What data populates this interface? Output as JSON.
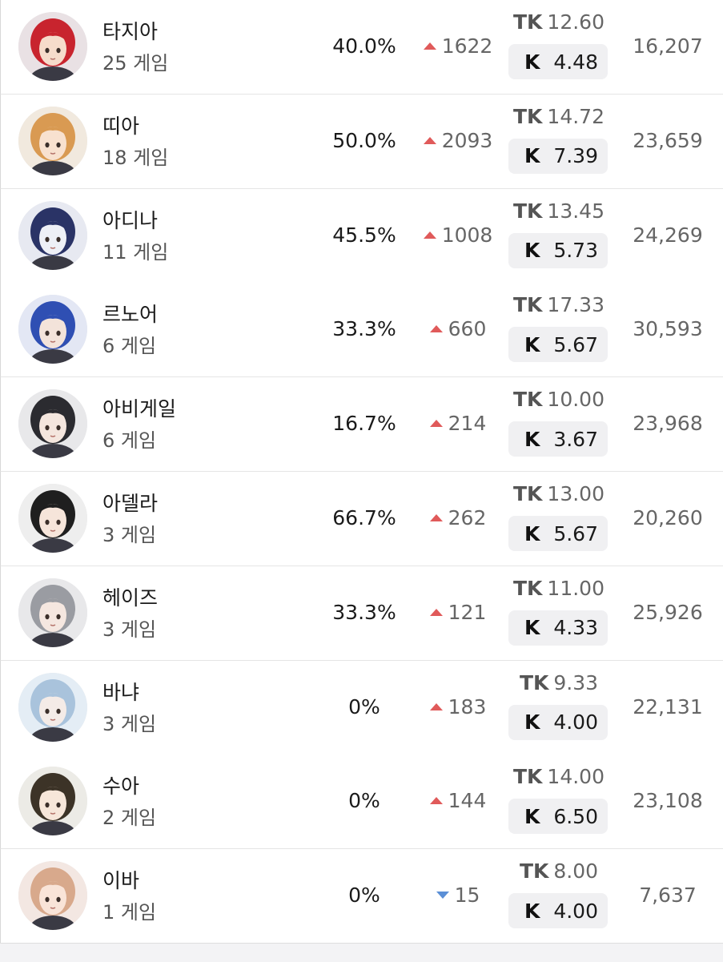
{
  "labels": {
    "tk": "TK",
    "k": "K"
  },
  "colors": {
    "up_arrow": "#e05a5a",
    "down_arrow": "#5b8fd6",
    "k_box_bg": "#f0f0f2"
  },
  "rows": [
    {
      "name": "타지아",
      "games": "25 게임",
      "winrate": "40.0%",
      "delta_dir": "up",
      "delta": "1622",
      "tk": "12.60",
      "k": "4.48",
      "score": "16,207",
      "avatar_bg": "#e9e1e4",
      "hair": "#c8242e",
      "skin": "#f6dccb"
    },
    {
      "name": "띠아",
      "games": "18 게임",
      "winrate": "50.0%",
      "delta_dir": "up",
      "delta": "2093",
      "tk": "14.72",
      "k": "7.39",
      "score": "23,659",
      "avatar_bg": "#f1e9de",
      "hair": "#d99a52",
      "skin": "#f8e1cf"
    },
    {
      "name": "아디나",
      "games": "11 게임",
      "winrate": "45.5%",
      "delta_dir": "up",
      "delta": "1008",
      "tk": "13.45",
      "k": "5.73",
      "score": "24,269",
      "avatar_bg": "#e7e9f1",
      "hair": "#2a3366",
      "skin": "#eef0f6"
    },
    {
      "name": "르노어",
      "games": "6 게임",
      "winrate": "33.3%",
      "delta_dir": "up",
      "delta": "660",
      "tk": "17.33",
      "k": "5.67",
      "score": "30,593",
      "avatar_bg": "#e3e7f4",
      "hair": "#2f4fb3",
      "skin": "#f3e3da"
    },
    {
      "name": "아비게일",
      "games": "6 게임",
      "winrate": "16.7%",
      "delta_dir": "up",
      "delta": "214",
      "tk": "10.00",
      "k": "3.67",
      "score": "23,968",
      "avatar_bg": "#e8e8ea",
      "hair": "#2b2b30",
      "skin": "#f4e6de"
    },
    {
      "name": "아델라",
      "games": "3 게임",
      "winrate": "66.7%",
      "delta_dir": "up",
      "delta": "262",
      "tk": "13.00",
      "k": "5.67",
      "score": "20,260",
      "avatar_bg": "#eeeeee",
      "hair": "#1f1f1f",
      "skin": "#f6e5da"
    },
    {
      "name": "헤이즈",
      "games": "3 게임",
      "winrate": "33.3%",
      "delta_dir": "up",
      "delta": "121",
      "tk": "11.00",
      "k": "4.33",
      "score": "25,926",
      "avatar_bg": "#e8e8ea",
      "hair": "#9a9ca2",
      "skin": "#f5e7e0"
    },
    {
      "name": "바냐",
      "games": "3 게임",
      "winrate": "0%",
      "delta_dir": "up",
      "delta": "183",
      "tk": "9.33",
      "k": "4.00",
      "score": "22,131",
      "avatar_bg": "#e4edf5",
      "hair": "#a9c3dc",
      "skin": "#f4ebe7"
    },
    {
      "name": "수아",
      "games": "2 게임",
      "winrate": "0%",
      "delta_dir": "up",
      "delta": "144",
      "tk": "14.00",
      "k": "6.50",
      "score": "23,108",
      "avatar_bg": "#ecebe6",
      "hair": "#3c3327",
      "skin": "#f6e6d9"
    },
    {
      "name": "이바",
      "games": "1 게임",
      "winrate": "0%",
      "delta_dir": "down",
      "delta": "15",
      "tk": "8.00",
      "k": "4.00",
      "score": "7,637",
      "avatar_bg": "#f3e7e2",
      "hair": "#d8a98c",
      "skin": "#f9e4d8"
    }
  ]
}
